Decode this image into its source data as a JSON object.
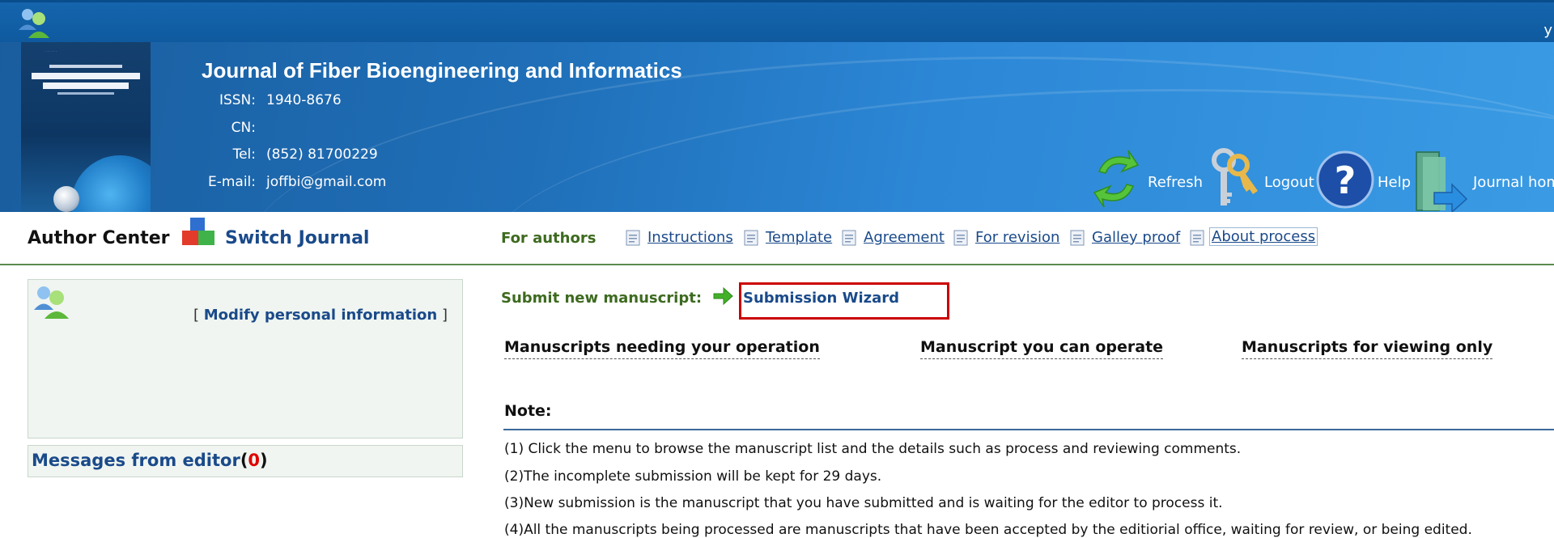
{
  "header": {
    "journal_title": "Journal of Fiber Bioengineering and Informatics",
    "cover_title": "JOURNAL OF FIBER BIOENGINEERING AND INFORMATICS",
    "topbar_right": "y",
    "info": [
      {
        "label": "ISSN:",
        "value": "1940-8676"
      },
      {
        "label": "CN:",
        "value": ""
      },
      {
        "label": "Tel:",
        "value": "(852) 81700229"
      },
      {
        "label": "E-mail:",
        "value": "joffbi@gmail.com"
      }
    ],
    "actions": {
      "refresh": "Refresh",
      "logout": "Logout",
      "help": "Help",
      "journal_home": "Journal home"
    }
  },
  "nav": {
    "author_center": "Author Center",
    "switch_journal": "Switch Journal",
    "for_authors": "For authors",
    "links": [
      "Instructions",
      "Template",
      "Agreement",
      "For revision",
      "Galley proof",
      "About process"
    ]
  },
  "sidebar": {
    "modify_prefix": "[",
    "modify_link": "Modify personal information",
    "modify_suffix": "]",
    "messages_label": "Messages from editor",
    "messages_open": "(",
    "messages_count": "0",
    "messages_close": ")"
  },
  "main": {
    "submit_label": "Submit new manuscript:",
    "wizard_link": "Submission Wizard",
    "tabs": [
      "Manuscripts needing your operation",
      "Manuscript you can operate",
      "Manuscripts for viewing only"
    ],
    "note_title": "Note:",
    "notes": [
      "(1) Click the menu to browse the manuscript list and the details such as process and reviewing comments.",
      "(2)The incomplete submission will be kept for 29 days.",
      "(3)New submission is the manuscript that you have submitted and is waiting for the editor to process it.",
      "(4)All the manuscripts being processed are manuscripts that have been accepted by the editiorial office, waiting for review, or being edited."
    ]
  },
  "colors": {
    "header_blue": "#1f6fb8",
    "link_blue": "#1a4a8a",
    "green_label": "#3d6a1f",
    "highlight_red": "#cc0000",
    "count_red": "#e00000"
  }
}
